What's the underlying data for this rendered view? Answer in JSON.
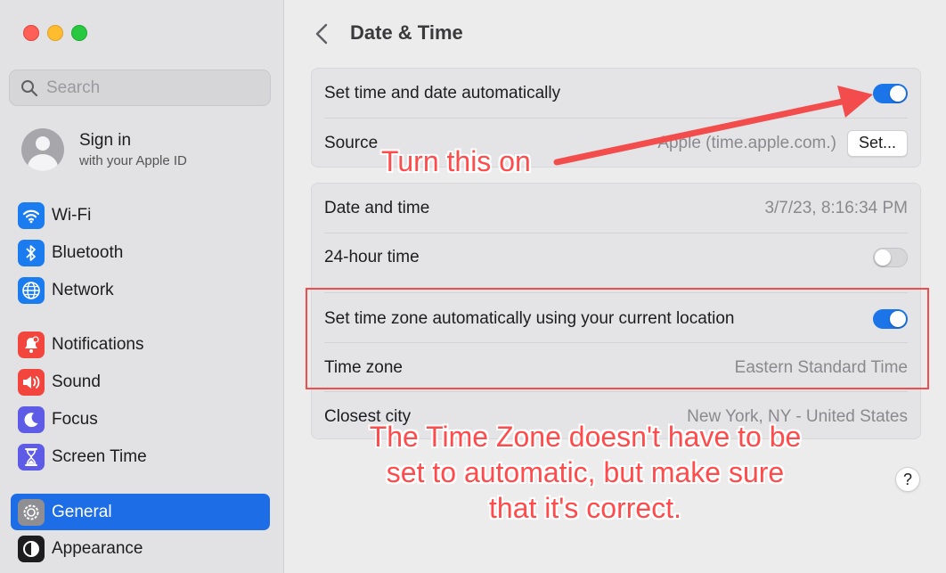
{
  "sidebar": {
    "search_placeholder": "Search",
    "signin": {
      "title": "Sign in",
      "subtitle": "with your Apple ID"
    },
    "items": [
      {
        "label": "Wi-Fi",
        "icon": "wifi-icon",
        "color": "#1b7cf0"
      },
      {
        "label": "Bluetooth",
        "icon": "bluetooth-icon",
        "color": "#1b7cf0"
      },
      {
        "label": "Network",
        "icon": "globe-icon",
        "color": "#1b7cf0"
      },
      {
        "label": "Notifications",
        "icon": "bell-icon",
        "color": "#f2453d"
      },
      {
        "label": "Sound",
        "icon": "speaker-icon",
        "color": "#f2453d"
      },
      {
        "label": "Focus",
        "icon": "moon-icon",
        "color": "#5e5ce6"
      },
      {
        "label": "Screen Time",
        "icon": "hourglass-icon",
        "color": "#5e5ce6"
      },
      {
        "label": "General",
        "icon": "gear-icon",
        "color": "#8e8e93",
        "active": true
      },
      {
        "label": "Appearance",
        "icon": "appearance-icon",
        "color": "#1d1d1f"
      }
    ]
  },
  "main": {
    "title": "Date & Time",
    "auto_time": {
      "label": "Set time and date automatically",
      "toggle": "on"
    },
    "source": {
      "label": "Source",
      "value": "Apple (time.apple.com.)",
      "button": "Set..."
    },
    "date_time": {
      "label": "Date and time",
      "value": "3/7/23, 8:16:34 PM"
    },
    "hour24": {
      "label": "24-hour time",
      "toggle": "off"
    },
    "auto_tz": {
      "label": "Set time zone automatically using your current location",
      "toggle": "on"
    },
    "time_zone": {
      "label": "Time zone",
      "value": "Eastern Standard Time"
    },
    "closest_city": {
      "label": "Closest city",
      "value": "New York, NY - United States"
    },
    "help": "?"
  },
  "annotations": {
    "turn_on": "Turn this on",
    "note": "The Time Zone doesn't have to be set to automatic, but make sure that it's correct.",
    "color": "#f24c4c"
  }
}
